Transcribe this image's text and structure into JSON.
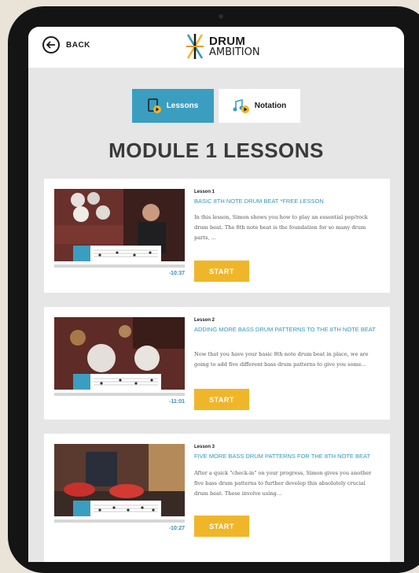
{
  "header": {
    "back_label": "BACK",
    "logo_line1": "DRUM",
    "logo_line2": "AMBITION"
  },
  "tabs": [
    {
      "label": "Lessons",
      "active": true
    },
    {
      "label": "Notation",
      "active": false
    }
  ],
  "page_title": "MODULE 1 LESSONS",
  "lessons": [
    {
      "number": "Lesson 1",
      "title": "BASIC 8TH NOTE DRUM BEAT *FREE LESSON",
      "description": "In this lesson, Simon shows you how to play an essential pop/rock drum beat. The 8th note beat is the foundation for so many drum parts, ...",
      "duration": "-10:37",
      "start_label": "START"
    },
    {
      "number": "Lesson 2",
      "title": "ADDING MORE BASS DRUM PATTERNS TO THE 8TH NOTE BEAT",
      "description": "Now that you have your basic 8th note drum beat in place, we are going to add five different bass drum patterns to give you some...",
      "duration": "-11:01",
      "start_label": "START"
    },
    {
      "number": "Lesson 3",
      "title": "FIVE MORE BASS DRUM PATTERNS FOR THE 8TH NOTE BEAT",
      "description": "After a quick \"check-in\" on your progress, Simon gives you another five bass drum patterns to further develop this absolutely crucial drum beat. These involve using...",
      "duration": "-10:27",
      "start_label": "START"
    }
  ],
  "colors": {
    "accent_blue": "#3b9ec0",
    "start_yellow": "#f0b62a",
    "link_blue": "#2f98c0"
  }
}
